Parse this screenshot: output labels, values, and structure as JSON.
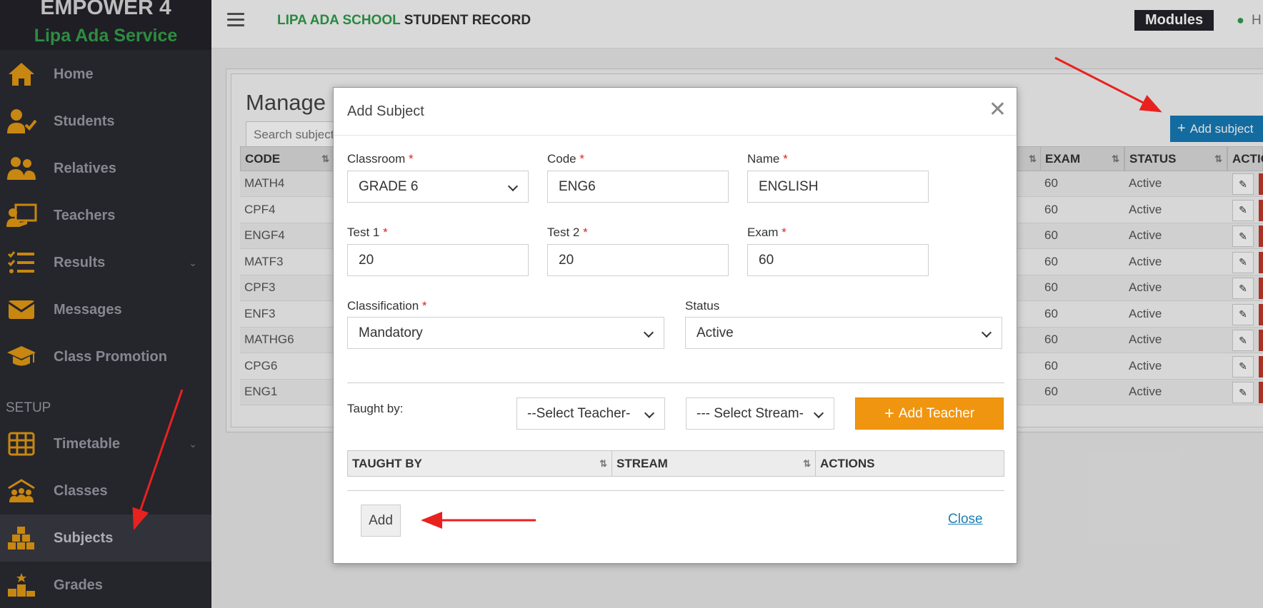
{
  "sidebar": {
    "brand_title": "EMPOWER 4",
    "brand_subtitle": "Lipa Ada Service",
    "items": [
      {
        "label": "Home",
        "icon": "home-icon"
      },
      {
        "label": "Students",
        "icon": "student-icon"
      },
      {
        "label": "Relatives",
        "icon": "users-icon"
      },
      {
        "label": "Teachers",
        "icon": "teacher-icon"
      },
      {
        "label": "Results",
        "icon": "list-check-icon"
      },
      {
        "label": "Messages",
        "icon": "envelope-icon"
      },
      {
        "label": "Class Promotion",
        "icon": "graduation-cap-icon"
      }
    ],
    "setup_label": "SETUP",
    "setup_items": [
      {
        "label": "Timetable",
        "icon": "calendar-grid-icon"
      },
      {
        "label": "Classes",
        "icon": "classroom-icon"
      },
      {
        "label": "Subjects",
        "icon": "cubes-icon"
      },
      {
        "label": "Grades",
        "icon": "podium-icon"
      }
    ]
  },
  "topbar": {
    "title_green": "LIPA ADA SCHOOL",
    "title_dark": "STUDENT RECORD",
    "modules_label": "Modules",
    "user_initial": "H"
  },
  "page": {
    "title": "Manage Su",
    "search_placeholder": "Search subject...",
    "add_subject_label": "Add subject",
    "columns": {
      "code": "CODE",
      "exam": "EXAM",
      "status": "STATUS",
      "actions": "ACTIO"
    },
    "rows": [
      {
        "code": "MATH4",
        "exam": "60",
        "status": "Active"
      },
      {
        "code": "CPF4",
        "exam": "60",
        "status": "Active"
      },
      {
        "code": "ENGF4",
        "exam": "60",
        "status": "Active"
      },
      {
        "code": "MATF3",
        "exam": "60",
        "status": "Active"
      },
      {
        "code": "CPF3",
        "exam": "60",
        "status": "Active"
      },
      {
        "code": "ENF3",
        "exam": "60",
        "status": "Active"
      },
      {
        "code": "MATHG6",
        "exam": "60",
        "status": "Active"
      },
      {
        "code": "CPG6",
        "exam": "60",
        "status": "Active"
      },
      {
        "code": "ENG1",
        "exam": "60",
        "status": "Active"
      }
    ]
  },
  "modal": {
    "title": "Add Subject",
    "classroom_label": "Classroom",
    "classroom_value": "GRADE 6",
    "code_label": "Code",
    "code_value": "ENG6",
    "name_label": "Name",
    "name_value": "ENGLISH",
    "test1_label": "Test 1",
    "test1_value": "20",
    "test2_label": "Test 2",
    "test2_value": "20",
    "exam_label": "Exam",
    "exam_value": "60",
    "classification_label": "Classification",
    "classification_value": "Mandatory",
    "status_label": "Status",
    "status_value": "Active",
    "taught_by_label": "Taught by:",
    "teacher_select": "--Select Teacher-",
    "stream_select": "--- Select Stream-",
    "add_teacher_label": "Add Teacher",
    "table_headers": [
      "TAUGHT BY",
      "STREAM",
      "ACTIONS"
    ],
    "add_label": "Add",
    "close_label": "Close",
    "required_mark": "*"
  },
  "colors": {
    "sidebar_bg": "#2b2b33",
    "icon_orange": "#e39a13",
    "brand_green": "#35a04b",
    "primary_blue": "#167bb7",
    "warning_orange": "#f0950f",
    "arrow_red": "#e8221f"
  }
}
